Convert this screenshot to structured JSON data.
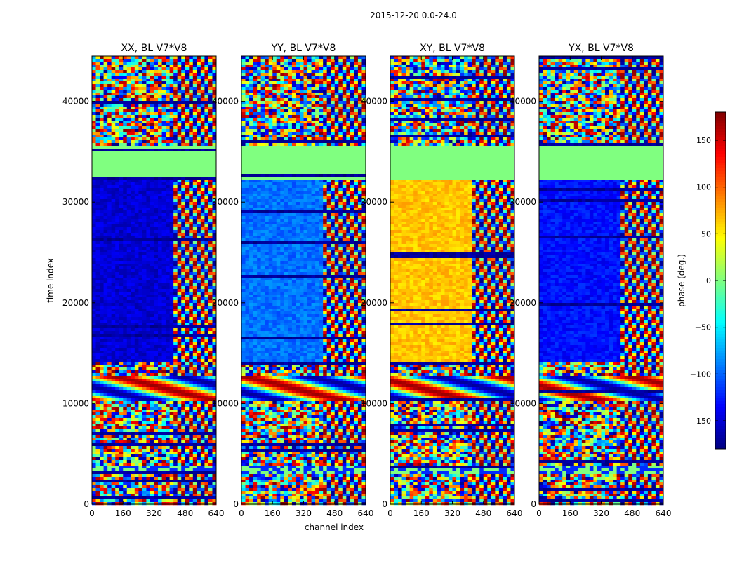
{
  "figure": {
    "suptitle": "2015-12-20 0.0-24.0"
  },
  "chart_data": {
    "type": "heatmap",
    "xlabel": "channel index",
    "ylabel": "time index",
    "xlim": [
      0,
      640
    ],
    "ylim": [
      0,
      44500
    ],
    "x_ticks": [
      0,
      160,
      320,
      480,
      640
    ],
    "y_ticks": [
      0,
      10000,
      20000,
      30000,
      40000
    ],
    "colormap": "jet",
    "colorbar": {
      "label": "phase (deg.)",
      "range": [
        -180,
        180
      ],
      "ticks": [
        150,
        100,
        50,
        0,
        -50,
        -100,
        -150
      ],
      "tick_labels": [
        "150",
        "100",
        "50",
        "0",
        "−50",
        "−100",
        "−150"
      ],
      "bottom_label": "......"
    },
    "panels": [
      {
        "title": "XX, BL V7*V8",
        "base_phase_deg": -150
      },
      {
        "title": "YY, BL V7*V8",
        "base_phase_deg": -95
      },
      {
        "title": "XY, BL V7*V8",
        "base_phase_deg": 65
      },
      {
        "title": "YX, BL V7*V8",
        "base_phase_deg": -130
      }
    ],
    "time_segments": [
      {
        "from": 0,
        "to": 4000,
        "kind": "noise"
      },
      {
        "from": 3200,
        "to": 3900,
        "kind": "mixed"
      },
      {
        "from": 4000,
        "to": 10500,
        "kind": "noise"
      },
      {
        "from": 10500,
        "to": 12800,
        "kind": "fringe"
      },
      {
        "from": 12800,
        "to": 14200,
        "kind": "noise"
      },
      {
        "from": 14200,
        "to": 32500,
        "kind": "coherent"
      },
      {
        "from": 32500,
        "to": 35800,
        "kind": "flat"
      },
      {
        "from": 35800,
        "to": 38200,
        "kind": "noise"
      },
      {
        "from": 38200,
        "to": 44500,
        "kind": "noise"
      }
    ]
  }
}
